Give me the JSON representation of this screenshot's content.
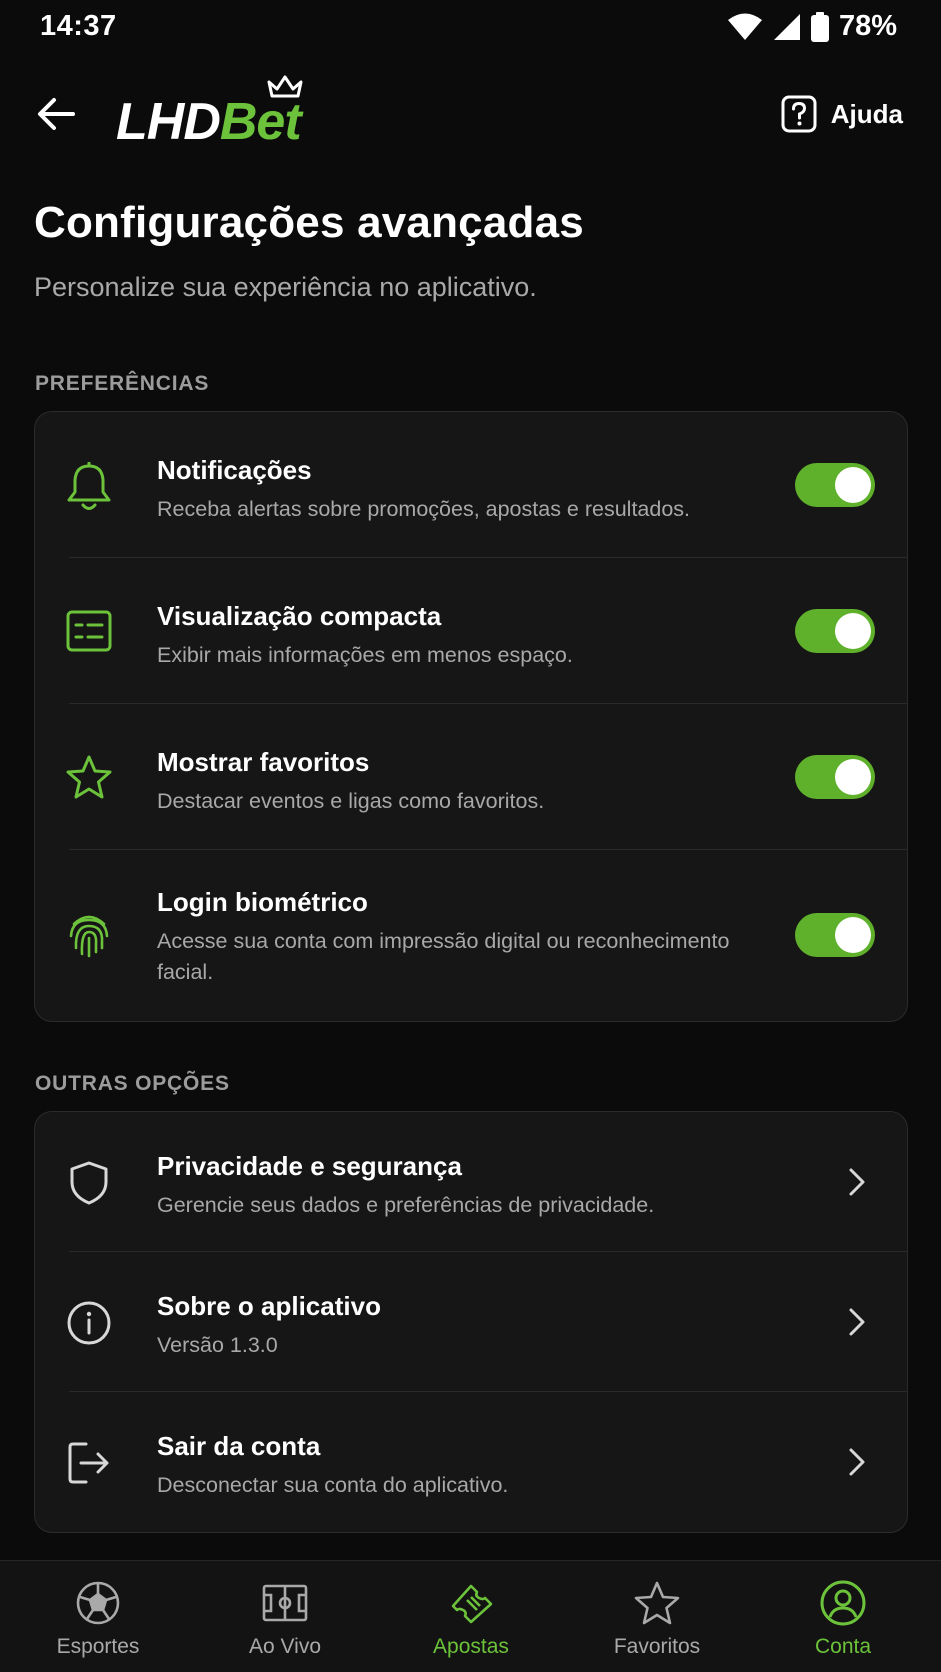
{
  "status_bar": {
    "time": "14:37",
    "battery": "78%",
    "icons": [
      "wifi-icon",
      "signal-icon",
      "battery-icon"
    ]
  },
  "header": {
    "logo_part1": "LHD",
    "logo_part2": "Bet",
    "help_label": "Ajuda"
  },
  "page": {
    "title": "Configurações avançadas",
    "subtitle": "Personalize sua experiência no aplicativo."
  },
  "preferences": {
    "section_label": "PREFERÊNCIAS",
    "items": [
      {
        "title": "Notificações",
        "description": "Receba alertas sobre promoções, apostas e resultados.",
        "icon": "bell-icon",
        "enabled": true
      },
      {
        "title": "Visualização compacta",
        "description": "Exibir mais informações em menos espaço.",
        "icon": "compact-list-icon",
        "enabled": true
      },
      {
        "title": "Mostrar favoritos",
        "description": "Destacar eventos e ligas como favoritos.",
        "icon": "star-icon",
        "enabled": true
      },
      {
        "title": "Login biométrico",
        "description": "Acesse sua conta com impressão digital ou reconhecimento facial.",
        "icon": "fingerprint-icon",
        "enabled": true
      }
    ]
  },
  "other_options": {
    "section_label": "OUTRAS OPÇÕES",
    "items": [
      {
        "title": "Privacidade e segurança",
        "description": "Gerencie seus dados e preferências de privacidade.",
        "icon": "shield-icon"
      },
      {
        "title": "Sobre o aplicativo",
        "description": "Versão 1.3.0",
        "icon": "info-icon"
      },
      {
        "title": "Sair da conta",
        "description": "Desconectar sua conta do aplicativo.",
        "icon": "logout-icon"
      }
    ]
  },
  "bottom_nav": {
    "items": [
      {
        "label": "Esportes",
        "icon": "soccer-ball-icon",
        "active": false
      },
      {
        "label": "Ao Vivo",
        "icon": "field-icon",
        "active": false
      },
      {
        "label": "Apostas",
        "icon": "ticket-icon",
        "active": false
      },
      {
        "label": "Favoritos",
        "icon": "star-icon",
        "active": false
      },
      {
        "label": "Conta",
        "icon": "account-icon",
        "active": true
      }
    ]
  },
  "colors": {
    "accent": "#6cc23a",
    "toggle_on": "#5fb12c",
    "background": "#0b0b0b",
    "card": "#161616"
  }
}
